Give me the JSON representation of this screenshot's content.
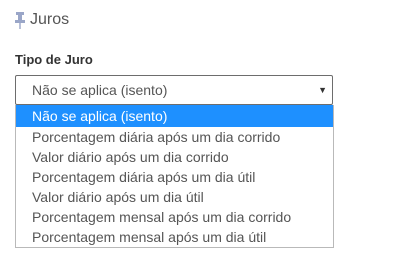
{
  "section": {
    "title": "Juros",
    "icon": "pushpin-icon",
    "icon_color": "#9aa6c8"
  },
  "field": {
    "label": "Tipo de Juro"
  },
  "select": {
    "value": "Não se aplica (isento)",
    "arrow": "▼",
    "options": [
      "Não se aplica (isento)",
      "Porcentagem diária após um dia corrido",
      "Valor diário após um dia corrido",
      "Porcentagem diária após um dia útil",
      "Valor diário após um dia útil",
      "Porcentagem mensal após um dia corrido",
      "Porcentagem mensal após um dia útil"
    ],
    "highlighted_index": 0,
    "highlight_color": "#1e90ff"
  }
}
